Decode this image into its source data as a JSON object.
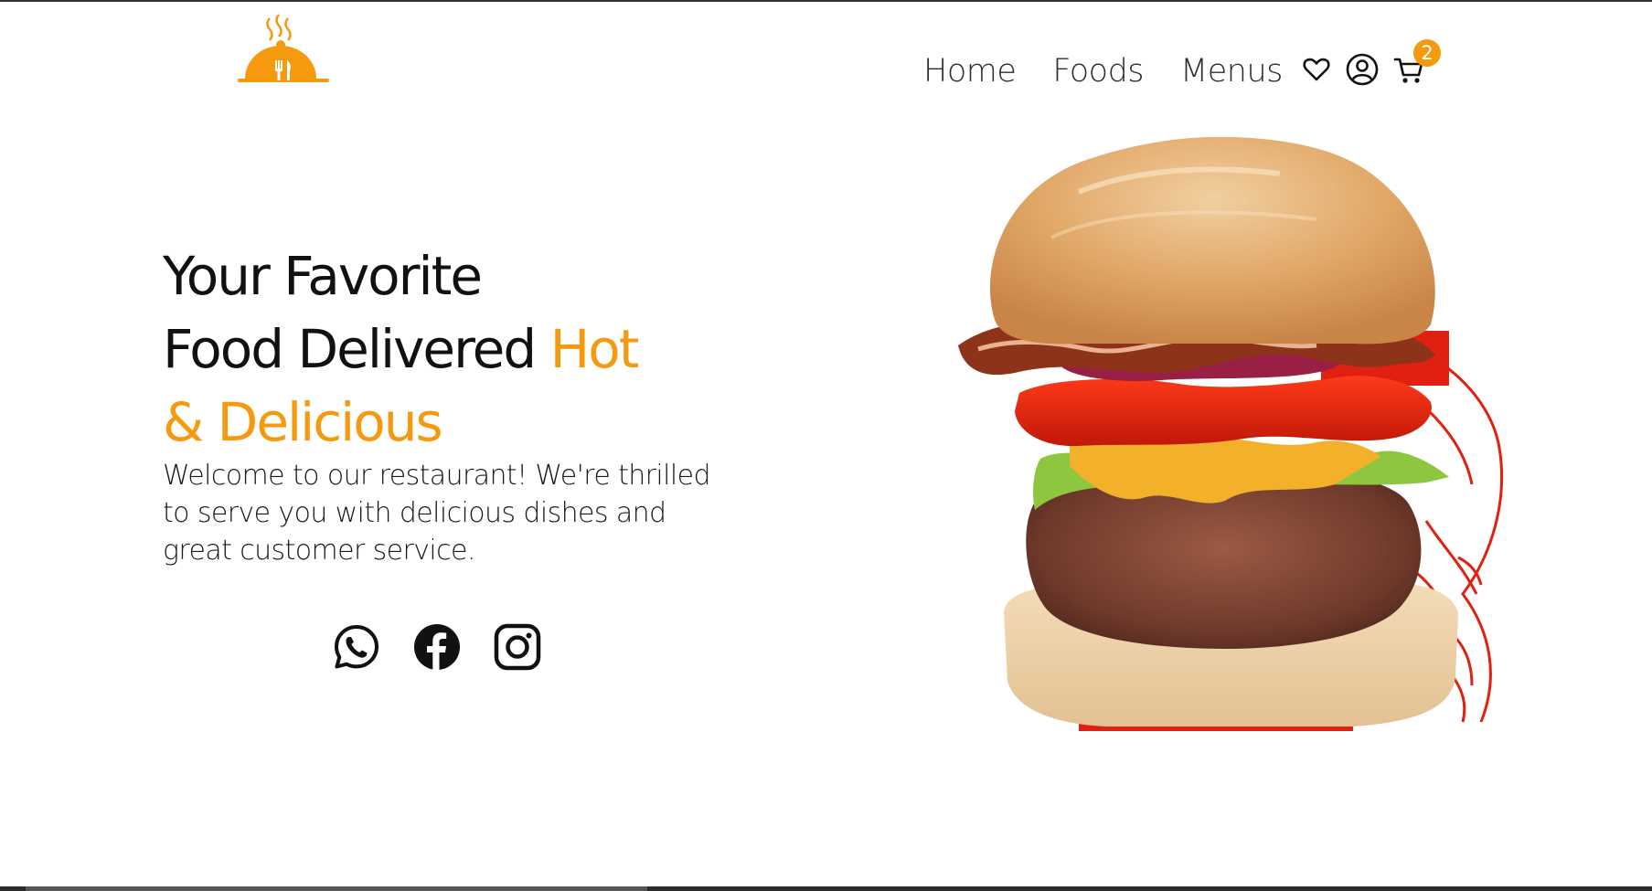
{
  "header": {
    "logo_icon": "cloche-with-cutlery-icon",
    "nav": [
      {
        "label": "Home"
      },
      {
        "label": "Foods"
      },
      {
        "label": "Menus"
      }
    ],
    "icons": [
      "heart-icon",
      "user-icon",
      "cart-icon"
    ],
    "cart_count": "2"
  },
  "hero": {
    "title_line1": "Your Favorite",
    "title_line2_main": "Food Delivered ",
    "title_line2_accent": "Hot",
    "title_line3_accent": "& Delicious",
    "subtitle": "Welcome to our restaurant! We're thrilled to serve you with delicious dishes and great customer service.",
    "image": "burger-image"
  },
  "social": {
    "icons": [
      "whatsapp-icon",
      "facebook-icon",
      "instagram-icon"
    ]
  },
  "colors": {
    "accent": "#f59a0f",
    "text": "#111111",
    "sketch_red": "#e02010"
  }
}
